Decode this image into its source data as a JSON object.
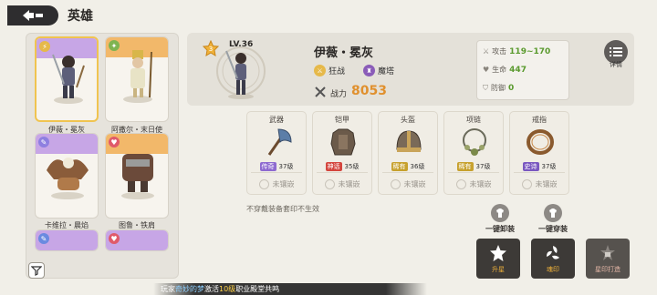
{
  "header": {
    "title": "英雄"
  },
  "heroes": [
    {
      "name": "伊薇・冕灰",
      "badge_color": "#e6b94a",
      "band": "#c7a6e6"
    },
    {
      "name": "阿撒尔・末日使",
      "badge_color": "#7fb451",
      "band": "#f2b86a"
    },
    {
      "name": "卡维拉・晨焰",
      "badge_color": "#8e7fe0",
      "band": "#c7a6e6"
    },
    {
      "name": "图鲁・铁肩",
      "badge_color": "#e05a6a",
      "band": "#f2b86a"
    }
  ],
  "hero_detail": {
    "level": "LV.36",
    "level_badge": "3",
    "name": "伊薇・冕灰",
    "class_label": "狂战",
    "race_label": "魔塔",
    "power_label": "战力",
    "power_value": "8053",
    "stats": {
      "attack_label": "攻击",
      "attack_value": "119~170",
      "hp_label": "生命",
      "hp_value": "447",
      "def_label": "防御",
      "def_value": "0"
    },
    "detail_label": "详情"
  },
  "equipment": [
    {
      "slot": "武器",
      "rank": "传奇",
      "rank_color": "#8e6ad0",
      "level": "37级",
      "unset": "未镶嵌"
    },
    {
      "slot": "铠甲",
      "rank": "神话",
      "rank_color": "#d4463e",
      "level": "35级",
      "unset": "未镶嵌"
    },
    {
      "slot": "头盔",
      "rank": "稀有",
      "rank_color": "#c7a12e",
      "level": "36级",
      "unset": "未镶嵌"
    },
    {
      "slot": "项链",
      "rank": "稀有",
      "rank_color": "#c7a12e",
      "level": "37级",
      "unset": "未镶嵌"
    },
    {
      "slot": "戒指",
      "rank": "史诗",
      "rank_color": "#7a58c0",
      "level": "37级",
      "unset": "未镶嵌"
    }
  ],
  "set_note": "不穿戴装备套印不生效",
  "actions": {
    "unequip_all": "一键卸装",
    "equip_all": "一键穿装",
    "star_up": "升星",
    "seal": "魂印",
    "star_seal_craft": "星印打造"
  },
  "marquee": {
    "prefix": "玩家",
    "name": "奇妙的梦",
    "middle": "激活",
    "highlight": "10级",
    "suffix": "职业殿堂共鸣"
  },
  "colors": {
    "accent": "#e0902e",
    "stat_green": "#5a9a2e",
    "dark_button": "#3d3a37"
  }
}
